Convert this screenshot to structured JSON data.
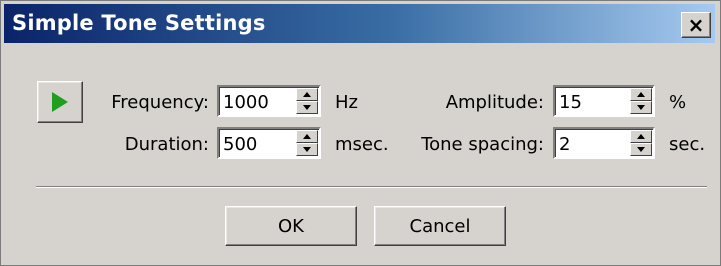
{
  "window": {
    "title": "Simple Tone Settings",
    "close_label": "×"
  },
  "fields": {
    "frequency": {
      "label": "Frequency:",
      "value": "1000",
      "unit": "Hz"
    },
    "duration": {
      "label": "Duration:",
      "value": "500",
      "unit": "msec."
    },
    "amplitude": {
      "label": "Amplitude:",
      "value": "15",
      "unit": "%"
    },
    "tone_spacing": {
      "label": "Tone spacing:",
      "value": "2",
      "unit": "sec."
    }
  },
  "buttons": {
    "ok": "OK",
    "cancel": "Cancel"
  },
  "icons": {
    "play": "play-icon",
    "close": "close-icon",
    "spin_up": "arrow-up-icon",
    "spin_down": "arrow-down-icon"
  },
  "colors": {
    "title_bar_start": "#0a246a",
    "title_bar_end": "#a6caf0",
    "dialog_face": "#d6d3ce",
    "play_green": "#1f9e1f"
  }
}
